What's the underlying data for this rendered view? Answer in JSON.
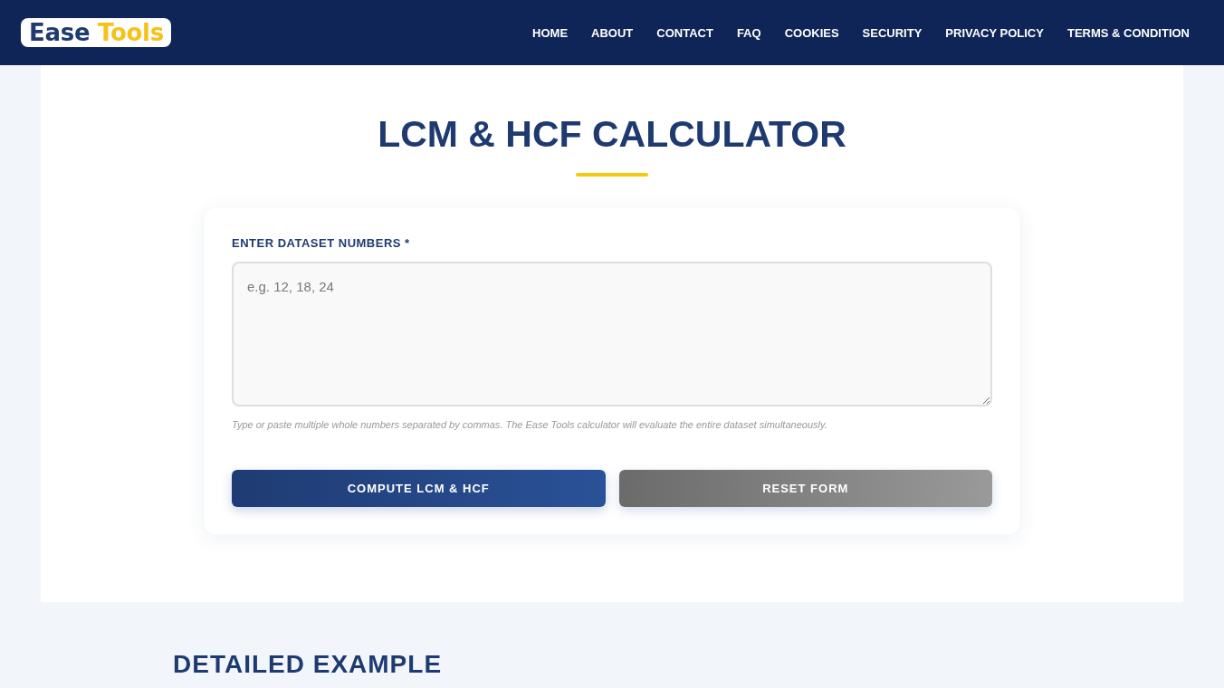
{
  "header": {
    "logo": {
      "first_word": "Ease",
      "second_word": "Tools"
    },
    "nav": [
      "HOME",
      "ABOUT",
      "CONTACT",
      "FAQ",
      "COOKIES",
      "SECURITY",
      "PRIVACY POLICY",
      "TERMS & CONDITION"
    ]
  },
  "calculator": {
    "title": "LCM & HCF CALCULATOR",
    "field_label": "ENTER DATASET NUMBERS *",
    "input": {
      "placeholder": "e.g. 12, 18, 24"
    },
    "hint": "Type or paste multiple whole numbers separated by commas. The Ease Tools calculator will evaluate the entire dataset simultaneously.",
    "buttons": [
      {
        "label": "COMPUTE LCM & HCF",
        "kind": "primary"
      },
      {
        "label": "RESET FORM",
        "kind": "secondary"
      }
    ]
  },
  "section": {
    "title": "DETAILED EXAMPLE"
  }
}
